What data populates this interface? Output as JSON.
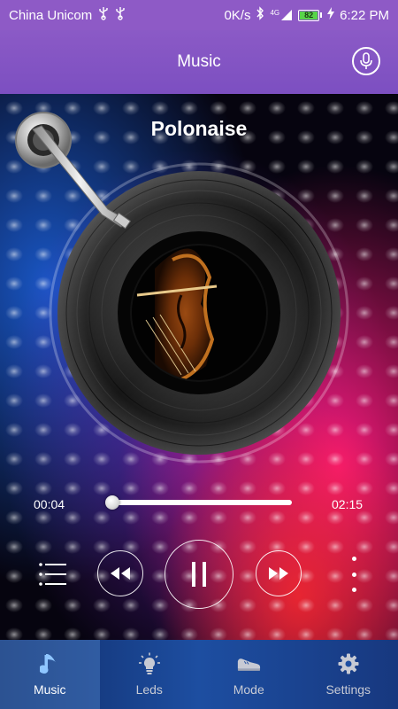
{
  "status_bar": {
    "carrier": "China Unicom",
    "network_speed": "0K/s",
    "network_type": "4G",
    "battery_level": "82",
    "time": "6:22 PM",
    "icons": [
      "usb-icon",
      "usb-icon",
      "bluetooth-icon",
      "signal-icon",
      "battery-icon"
    ]
  },
  "header": {
    "title": "Music",
    "mic_icon": "microphone-icon"
  },
  "player": {
    "song_title": "Polonaise",
    "current_time": "00:04",
    "total_time": "02:15",
    "progress_fraction": 0.03,
    "state": "playing",
    "controls": {
      "playlist_icon": "playlist-icon",
      "prev_icon": "rewind-icon",
      "pause_icon": "pause-icon",
      "next_icon": "fast-forward-icon",
      "more_icon": "more-vertical-icon"
    }
  },
  "bottom_nav": {
    "active_index": 0,
    "items": [
      {
        "label": "Music",
        "icon": "music-note-icon"
      },
      {
        "label": "Leds",
        "icon": "lightbulb-icon"
      },
      {
        "label": "Mode",
        "icon": "shoe-icon"
      },
      {
        "label": "Settings",
        "icon": "gear-icon"
      }
    ]
  },
  "colors": {
    "header": "#8b5ac6",
    "progress_fill": "#f3d63c",
    "nav_background": "#1d4ea1",
    "nav_active": "#ffffff"
  }
}
